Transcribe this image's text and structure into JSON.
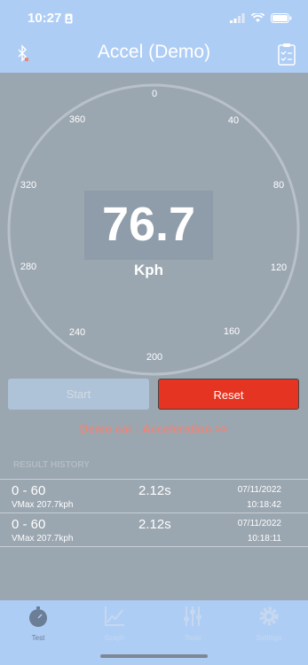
{
  "status": {
    "time": "10:27"
  },
  "nav": {
    "title": "Accel (Demo)"
  },
  "gauge": {
    "ticks": [
      "0",
      "40",
      "80",
      "120",
      "160",
      "200",
      "240",
      "280",
      "320",
      "360"
    ],
    "speed": "76.7",
    "unit": "Kph"
  },
  "buttons": {
    "start": "Start",
    "reset": "Reset"
  },
  "demo_link": "Demo car : Acceleration >>",
  "history": {
    "header": "RESULT HISTORY",
    "rows": [
      {
        "range": "0 - 60",
        "vmax": "VMax 207.7kph",
        "time": "2.12s",
        "date": "07/11/2022",
        "clock": "10:18:42"
      },
      {
        "range": "0 - 60",
        "vmax": "VMax 207.7kph",
        "time": "2.12s",
        "date": "07/11/2022",
        "clock": "10:18:11"
      }
    ]
  },
  "tabs": [
    {
      "label": "Test",
      "icon": "stopwatch-icon",
      "active": true
    },
    {
      "label": "Graph",
      "icon": "chart-icon",
      "active": false
    },
    {
      "label": "Tools",
      "icon": "sliders-icon",
      "active": false
    },
    {
      "label": "Settings",
      "icon": "gear-icon",
      "active": false
    }
  ],
  "colors": {
    "nav": "#aecdf5",
    "reset": "#e63422",
    "demo_link": "#e9877a"
  }
}
